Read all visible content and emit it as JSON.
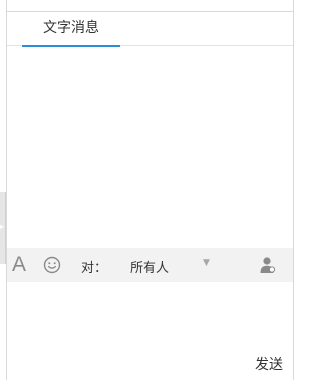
{
  "tabs": [
    {
      "label": "文字消息",
      "active": true
    }
  ],
  "toolbar": {
    "font_icon_glyph": "A",
    "to_label": "对：",
    "recipient": "所有人",
    "dropdown_glyph": "▼"
  },
  "input": {
    "send_label": "发送"
  },
  "colors": {
    "active_tab": "#2b8fd6",
    "toolbar_bg": "#f2f2f2",
    "icon_gray": "#8a8a8a"
  },
  "icons": [
    "font-icon",
    "emoji-icon",
    "user-icon",
    "collapse-arrow-icon"
  ]
}
